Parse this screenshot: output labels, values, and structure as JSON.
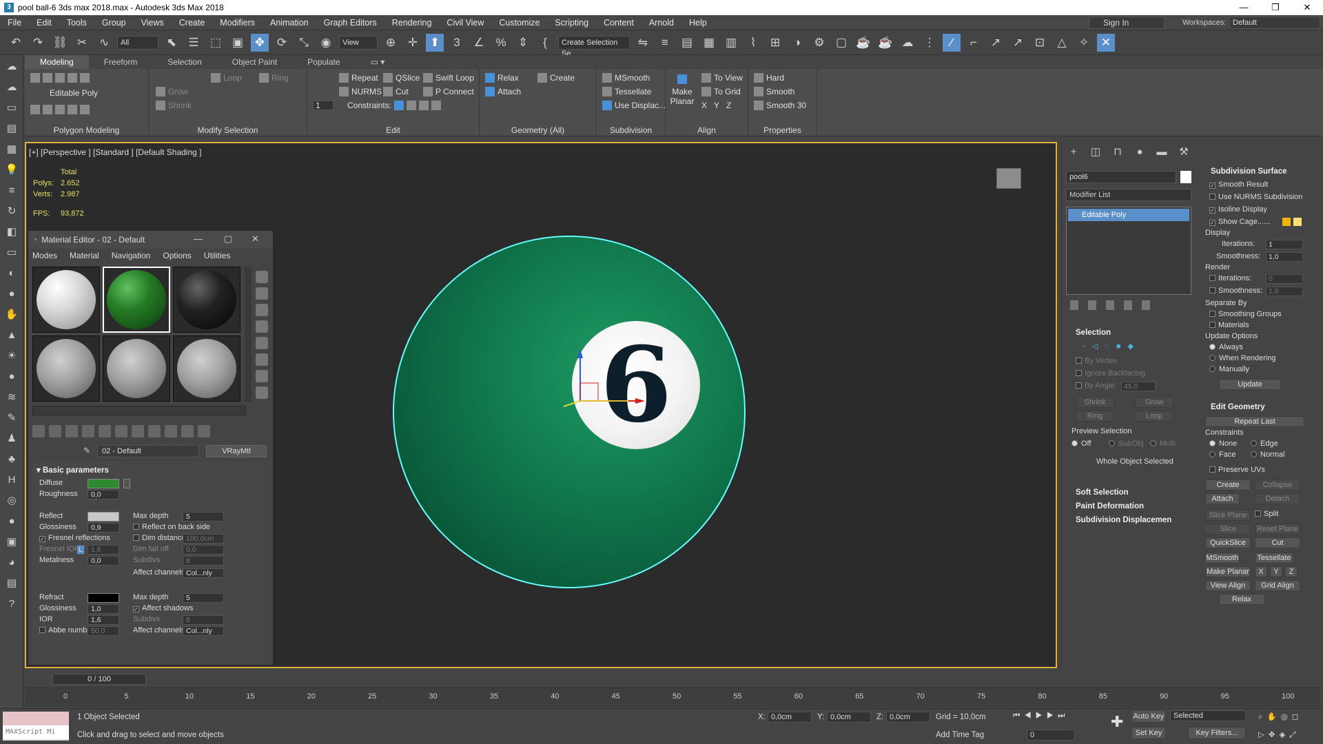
{
  "window": {
    "title": "pool ball-6 3ds max 2018.max - Autodesk 3ds Max 2018",
    "minimize": "—",
    "maximize": "❐",
    "close": "✕"
  },
  "menubar": {
    "items": [
      "File",
      "Edit",
      "Tools",
      "Group",
      "Views",
      "Create",
      "Modifiers",
      "Animation",
      "Graph Editors",
      "Rendering",
      "Civil View",
      "Customize",
      "Scripting",
      "Content",
      "Arnold",
      "Help"
    ],
    "signin": "Sign In",
    "workspaces_label": "Workspaces:",
    "workspace_value": "Default"
  },
  "toolbar": {
    "selection_filter": "All",
    "ref_coord": "View",
    "selection_set": "Create Selection Se"
  },
  "ribbon": {
    "tabs": [
      "Modeling",
      "Freeform",
      "Selection",
      "Object Paint",
      "Populate"
    ],
    "active_tab": "Modeling",
    "polygon_modeling": {
      "label": "Editable Poly",
      "title": "Polygon Modeling"
    },
    "modify_selection": {
      "grow": "Grow",
      "shrink": "Shrink",
      "loop": "Loop",
      "ring": "Ring",
      "title": "Modify Selection"
    },
    "edit": {
      "repeat": "Repeat",
      "qslice": "QSlice",
      "swift_loop": "Swift Loop",
      "nurms": "NURMS",
      "cut": "Cut",
      "p_connect": "P Connect",
      "constraints": "Constraints:",
      "value": "1",
      "title": "Edit"
    },
    "geometry": {
      "relax": "Relax",
      "create": "Create",
      "attach": "Attach",
      "title": "Geometry (All)"
    },
    "subdivision": {
      "msmooth": "MSmooth",
      "tessellate": "Tessellate",
      "use_displace": "Use Displac...",
      "title": "Subdivision"
    },
    "align": {
      "make_planar": "Make Planar",
      "to_view": "To View",
      "to_grid": "To Grid",
      "x": "X",
      "y": "Y",
      "z": "Z",
      "title": "Align"
    },
    "properties": {
      "hard": "Hard",
      "smooth": "Smooth",
      "smooth30": "Smooth 30",
      "title": "Properties"
    }
  },
  "viewport": {
    "label": "[+] [Perspective ] [Standard ] [Default Shading ]",
    "stats": {
      "total": "Total",
      "polys_label": "Polys:",
      "polys": "2.652",
      "verts_label": "Verts:",
      "verts": "2.987",
      "fps_label": "FPS:",
      "fps": "93,872"
    },
    "ball_number": "6",
    "colors": {
      "border": "#e0b23a",
      "selection": "#66ffff",
      "ball_green": "#117a4e"
    }
  },
  "material_editor": {
    "title": "Material Editor - 02 - Default",
    "menu": [
      "Modes",
      "Material",
      "Navigation",
      "Options",
      "Utilities"
    ],
    "material_name": "02 - Default",
    "material_type": "VRayMtl",
    "basic_title": "Basic parameters",
    "diffuse_label": "Diffuse",
    "diffuse_color": "#2f8a2f",
    "roughness_label": "Roughness",
    "roughness": "0,0",
    "reflect_label": "Reflect",
    "reflect_color": "#c8c8c8",
    "glossiness_label": "Glossiness",
    "glossiness": "0,9",
    "fresnel_label": "Fresnel reflections",
    "fresnel_ior_label": "Fresnel IOR",
    "fresnel_ior_l": "L",
    "fresnel_ior": "1,6",
    "metalness_label": "Metalness",
    "metalness": "0,0",
    "max_depth_label": "Max depth",
    "max_depth": "5",
    "reflect_back_label": "Reflect on back side",
    "dim_distance_label": "Dim distance",
    "dim_distance": "100,0cm",
    "dim_falloff_label": "Dim fall off",
    "dim_falloff": "0,0",
    "subdivs_label": "Subdivs",
    "subdivs": "8",
    "affect_channels_label": "Affect channels",
    "affect_channels": "Col...nly",
    "refract_label": "Refract",
    "refract_color": "#000000",
    "refract_glossiness": "1,0",
    "ior_label": "IOR",
    "ior": "1,6",
    "abbe_label": "Abbe number",
    "abbe": "50,0",
    "refract_max_depth": "5",
    "affect_shadows_label": "Affect shadows",
    "refract_subdivs": "8",
    "refract_affect_channels": "Col...nly"
  },
  "command_panel": {
    "object_name": "pool6",
    "modifier_list": "Modifier List",
    "stack_item": "Editable Poly",
    "selection": {
      "title": "Selection",
      "by_vertex": "By Vertex",
      "ignore_backfacing": "Ignore Backfacing",
      "by_angle": "By Angle:",
      "angle": "45,0",
      "shrink": "Shrink",
      "grow": "Grow",
      "ring": "Ring",
      "loop": "Loop",
      "preview_label": "Preview Selection",
      "off": "Off",
      "subobj": "SubObj",
      "multi": "Multi",
      "status": "Whole Object Selected"
    },
    "soft_selection": "Soft Selection",
    "paint_deformation": "Paint Deformation",
    "subdivision_displacement": "Subdivision Displacemen",
    "subdiv_surface": {
      "title": "Subdivision Surface",
      "smooth_result": "Smooth Result",
      "use_nurms": "Use NURMS Subdivision",
      "isoline": "Isoline Display",
      "show_cage": "Show Cage......",
      "display": "Display",
      "iterations_label": "Iterations:",
      "iterations": "1",
      "smoothness_label": "Smoothness:",
      "smoothness": "1,0",
      "render": "Render",
      "render_iterations": "0",
      "render_smoothness": "1,0",
      "separate_by": "Separate By",
      "smoothing_groups": "Smoothing Groups",
      "materials": "Materials",
      "update_options": "Update Options",
      "always": "Always",
      "when_rendering": "When Rendering",
      "manually": "Manually",
      "update": "Update",
      "cage_color1": "#f0b400",
      "cage_color2": "#f5e07a"
    },
    "edit_geometry": {
      "title": "Edit Geometry",
      "repeat_last": "Repeat Last",
      "constraints": "Constraints",
      "none": "None",
      "edge": "Edge",
      "face": "Face",
      "normal": "Normal",
      "preserve_uvs": "Preserve UVs",
      "create": "Create",
      "collapse": "Collapse",
      "attach": "Attach",
      "detach": "Detach",
      "slice_plane": "Slice Plane",
      "split": "Split",
      "slice": "Slice",
      "reset_plane": "Reset Plane",
      "quickslice": "QuickSlice",
      "cut": "Cut",
      "msmooth": "MSmooth",
      "tessellate": "Tessellate",
      "make_planar": "Make Planar",
      "x": "X",
      "y": "Y",
      "z": "Z",
      "view_align": "View Align",
      "grid_align": "Grid Align",
      "relax": "Relax"
    }
  },
  "timeline": {
    "frame": "0 / 100",
    "ticks": [
      "0",
      "5",
      "10",
      "15",
      "20",
      "25",
      "30",
      "35",
      "40",
      "45",
      "50",
      "55",
      "60",
      "65",
      "70",
      "75",
      "80",
      "85",
      "90",
      "95",
      "100"
    ]
  },
  "status": {
    "maxscript": "MAXScript Mi",
    "objects_selected": "1 Object Selected",
    "prompt": "Click and drag to select and move objects",
    "x_label": "X:",
    "x": "0,0cm",
    "y_label": "Y:",
    "y": "0,0cm",
    "z_label": "Z:",
    "z": "0,0cm",
    "grid": "Grid = 10,0cm",
    "add_time_tag": "Add Time Tag",
    "auto_key": "Auto Key",
    "selected": "Selected",
    "set_key": "Set Key",
    "key_filters": "Key Filters...",
    "frame_field": "0"
  }
}
